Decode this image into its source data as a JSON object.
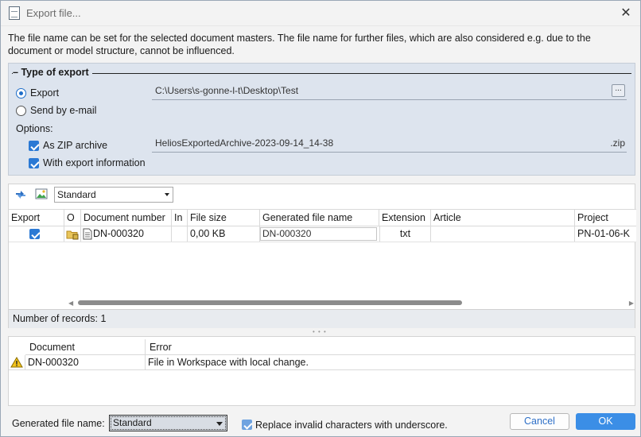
{
  "window": {
    "title": "Export file...",
    "close_glyph": "✕"
  },
  "intro_text": "The file name can be set for the selected document masters. The file name for further files, which are also considered e.g. due to the document or model structure, cannot be influenced.",
  "type_of_export": {
    "legend": "Type of export",
    "export_label": "Export",
    "export_selected": true,
    "email_label": "Send by e-mail",
    "email_selected": false,
    "options_label": "Options:",
    "zip_label": "As ZIP archive",
    "zip_checked": true,
    "info_label": "With export information",
    "info_checked": true,
    "path_value": "C:\\Users\\s-gonne-l-t\\Desktop\\Test",
    "browse_label": "...",
    "archive_name": "HeliosExportedArchive-2023-09-14_14-38",
    "archive_ext": ".zip"
  },
  "toolbar": {
    "refresh_icon": "refresh-arrows-icon",
    "image_icon": "image-preview-icon",
    "view_combo_value": "Standard"
  },
  "grid": {
    "headers": {
      "export": "Export",
      "o": "O",
      "document_number": "Document number",
      "in": "In",
      "file_size": "File size",
      "generated_file_name": "Generated file name",
      "extension": "Extension",
      "article": "Article",
      "project": "Project"
    },
    "rows": [
      {
        "export_checked": true,
        "document_number": "DN-000320",
        "in": "",
        "file_size": "0,00 KB",
        "generated_file_name": "DN-000320",
        "extension": "txt",
        "article": "",
        "project": "PN-01-06-K"
      }
    ],
    "records_label": "Number of records: 1"
  },
  "errors": {
    "headers": {
      "document": "Document",
      "error": "Error"
    },
    "rows": [
      {
        "document": "DN-000320",
        "error": "File in Workspace with local change."
      }
    ]
  },
  "footer": {
    "generated_label": "Generated file name:",
    "generated_value": "Standard",
    "replace_label": "Replace invalid characters with underscore.",
    "replace_checked": true,
    "cancel_label": "Cancel",
    "ok_label": "OK"
  },
  "colors": {
    "accent": "#3b8ee6",
    "group_bg": "#dde4ee"
  }
}
